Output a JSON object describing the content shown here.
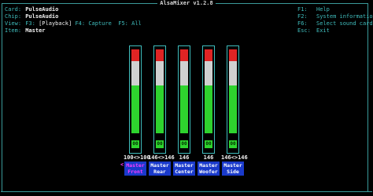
{
  "window": {
    "title": "AlsaMixer v1.2.8"
  },
  "info": {
    "card_label": "Card:",
    "card_value": "PulseAudio",
    "chip_label": "Chip:",
    "chip_value": "PulseAudio",
    "view_label": "View:",
    "view_f3": "F3:",
    "view_playback": "[Playback]",
    "view_rest": "F4: Capture  F5: All",
    "item_label": "Item:",
    "item_value": "Master"
  },
  "keys": [
    {
      "key": "F1:",
      "desc": "Help"
    },
    {
      "key": "F2:",
      "desc": "System information"
    },
    {
      "key": "F6:",
      "desc": "Select sound card"
    },
    {
      "key": "Esc:",
      "desc": "Exit"
    }
  ],
  "controls": [
    {
      "volume": "100<>100",
      "name1": "Master",
      "name2": "Front",
      "selected": true,
      "level": "00"
    },
    {
      "volume": "146<>146",
      "name1": "Master",
      "name2": "Rear",
      "selected": false,
      "level": "00"
    },
    {
      "volume": "146",
      "name1": "Master",
      "name2": "Center",
      "selected": false,
      "level": "00"
    },
    {
      "volume": "146",
      "name1": "Master",
      "name2": "Woofer",
      "selected": false,
      "level": "00"
    },
    {
      "volume": "146<>146",
      "name1": "Master",
      "name2": "Side",
      "selected": false,
      "level": "00"
    }
  ],
  "selection_marker": "<",
  "colors": {
    "frame": "#3a9a9a",
    "label": "#3fbcbc",
    "red": "#e02424",
    "green": "#2ed32e",
    "white": "#d0d0d0",
    "name_bg": "#1a3acb",
    "selected": "#ff3cff"
  }
}
